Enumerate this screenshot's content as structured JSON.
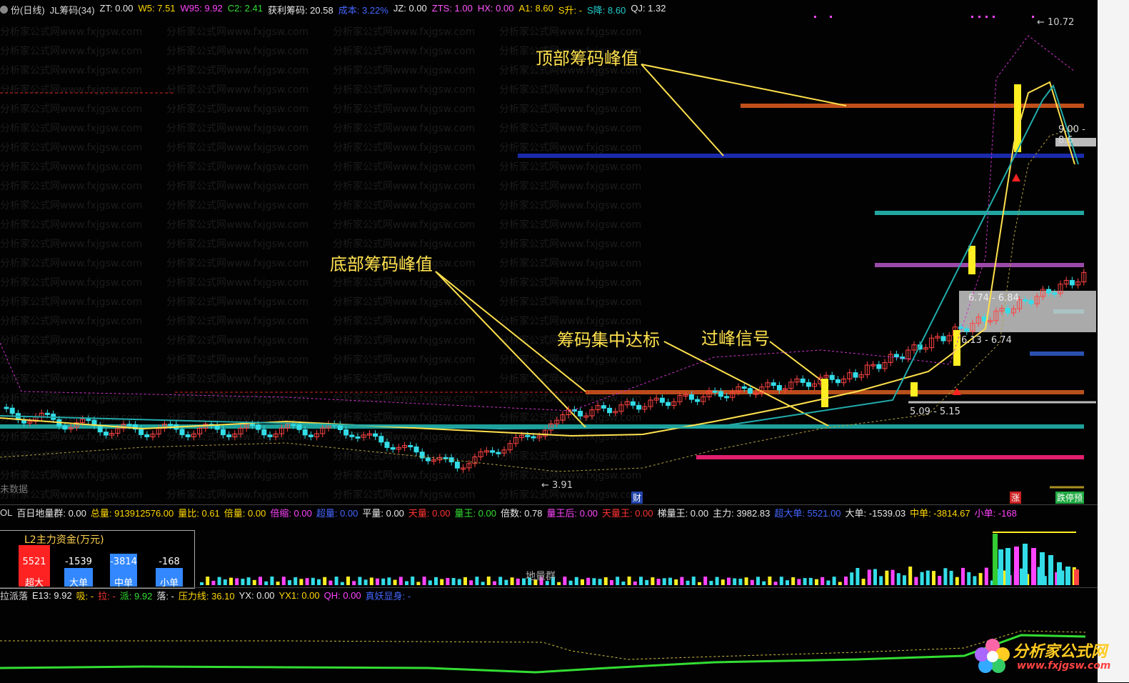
{
  "window": {
    "title_fragment": "份(日线)",
    "indicator_name": "JL筹码(34)"
  },
  "topbar": [
    {
      "text": "份(日线)",
      "color": "#d8d8d8"
    },
    {
      "text": "JL筹码(34)",
      "color": "#d8d8d8"
    },
    {
      "text": "ZT: 0.00",
      "color": "#e8e8e8"
    },
    {
      "text": "W5: 7.51",
      "color": "#ffd700"
    },
    {
      "text": "W95: 9.92",
      "color": "#ff44ff"
    },
    {
      "text": "C2: 2.41",
      "color": "#33dd33"
    },
    {
      "text": "获利筹码: 20.58",
      "color": "#e8e8e8"
    },
    {
      "text": "成本: 3.22%",
      "color": "#4466ff"
    },
    {
      "text": "JZ: 0.00",
      "color": "#e8e8e8"
    },
    {
      "text": "ZTS: 1.00",
      "color": "#ff55ff"
    },
    {
      "text": "HX: 0.00",
      "color": "#ff55ff"
    },
    {
      "text": "A1: 8.60",
      "color": "#ffd700"
    },
    {
      "text": "S升: -",
      "color": "#ffd700"
    },
    {
      "text": "S降: 8.60",
      "color": "#22cccc"
    },
    {
      "text": "QJ: 1.32",
      "color": "#e8e8e8"
    }
  ],
  "annotations": {
    "top_peak": "顶部筹码峰值",
    "bottom_peak": "底部筹码峰值",
    "concentration": "筹码集中达标",
    "cross_signal": "过峰信号"
  },
  "price_labels": {
    "high": "10.72",
    "low": "3.91",
    "range_top": "9.00 - 8.6",
    "range_mid": "6.74 - 6.84",
    "range_mid2": "6.13 - 6.74",
    "range_low": "5.09 - 5.15",
    "no_data": "未数据",
    "cai": "财",
    "zhang": "涨",
    "tag_right": "跌停预"
  },
  "volume_row": [
    {
      "text": "OL",
      "color": "#d8d8d8"
    },
    {
      "text": "百日地量群: 0.00",
      "color": "#e8e8e8"
    },
    {
      "text": "总量: 913912576.00",
      "color": "#ffd700"
    },
    {
      "text": "量比: 0.61",
      "color": "#ffd700"
    },
    {
      "text": "倍量: 0.00",
      "color": "#ffd700"
    },
    {
      "text": "倍缩: 0.00",
      "color": "#ff44ff"
    },
    {
      "text": "超量: 0.00",
      "color": "#4466ff"
    },
    {
      "text": "平量: 0.00",
      "color": "#e8e8e8"
    },
    {
      "text": "天量: 0.00",
      "color": "#ff3333"
    },
    {
      "text": "量王: 0.00",
      "color": "#33dd33"
    },
    {
      "text": "倍数: 0.78",
      "color": "#e8e8e8"
    },
    {
      "text": "量王后: 0.00",
      "color": "#ff44ff"
    },
    {
      "text": "天量王: 0.00",
      "color": "#ff3333"
    },
    {
      "text": "梯量王: 0.00",
      "color": "#e8e8e8"
    },
    {
      "text": "主力: 3982.83",
      "color": "#e8e8e8"
    },
    {
      "text": "超大单: 5521.00",
      "color": "#4466ff"
    },
    {
      "text": "大单: -1539.03",
      "color": "#e8e8e8"
    },
    {
      "text": "中单: -3814.67",
      "color": "#ffd700"
    },
    {
      "text": "小单: -168",
      "color": "#ff44ff"
    }
  ],
  "l2": {
    "title": "L2主力资金(万元)",
    "bars": [
      {
        "value": "5521",
        "label": "超大",
        "color": "#ff2222"
      },
      {
        "value": "-1539",
        "label": "大单",
        "color": "#3388ff"
      },
      {
        "value": "-3814",
        "label": "中单",
        "color": "#3388ff"
      },
      {
        "value": "-168",
        "label": "小单",
        "color": "#3388ff"
      }
    ]
  },
  "volume_caption": "地量群",
  "bottom_row": [
    {
      "text": "拉派落",
      "color": "#d8d8d8"
    },
    {
      "text": "E13: 9.92",
      "color": "#e8e8e8"
    },
    {
      "text": "吸: -",
      "color": "#ffd700"
    },
    {
      "text": "拉: -",
      "color": "#ff3333"
    },
    {
      "text": "派: 9.92",
      "color": "#33dd33"
    },
    {
      "text": "落: -",
      "color": "#e8e8e8"
    },
    {
      "text": "压力线: 36.10",
      "color": "#ffd700"
    },
    {
      "text": "YX: 0.00",
      "color": "#e8e8e8"
    },
    {
      "text": "YX1: 0.00",
      "color": "#ffd700"
    },
    {
      "text": "QH: 0.00",
      "color": "#ff44ff"
    },
    {
      "text": "真妖显身: -",
      "color": "#4466ff"
    }
  ],
  "logo": {
    "name": "分析家公式网",
    "url": "www.fxjgsw.com"
  },
  "watermark": "分析家公式网www.fxjgsw.com"
}
